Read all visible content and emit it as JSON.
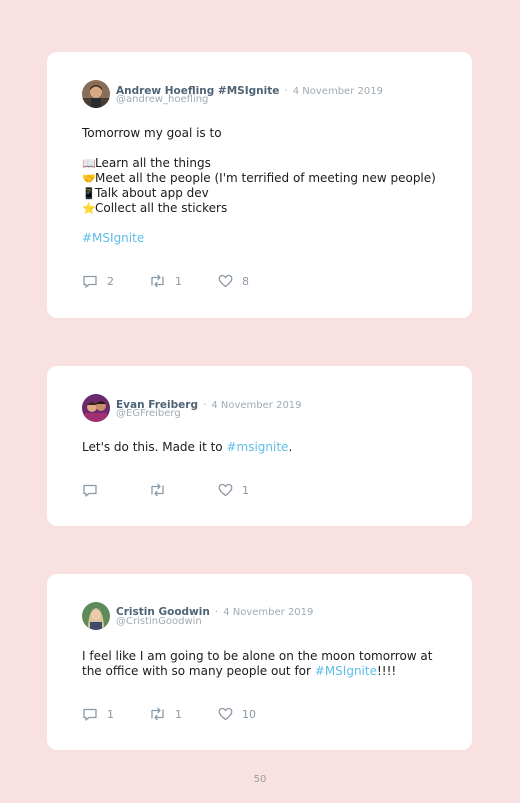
{
  "tweets": [
    {
      "author": "Andrew Hoefling #MSIgnite",
      "separator": "·",
      "date": "4 November 2019",
      "handle": "@andrew_hoefling",
      "lines": {
        "intro": "Tomorrow my goal is to",
        "item1_emoji": "📖",
        "item1": "Learn all the things",
        "item2_emoji": "🤝",
        "item2": "Meet all the people (I'm terrified of meeting new people)",
        "item3_emoji": "📱",
        "item3": "Talk about app dev",
        "item4_emoji": "⭐",
        "item4": "Collect all the stickers",
        "hashtag": "#MSIgnite"
      },
      "replies": "2",
      "retweets": "1",
      "likes": "8"
    },
    {
      "author": "Evan Freiberg",
      "separator": "·",
      "date": "4 November 2019",
      "handle": "@EGFreiberg",
      "lines": {
        "before": "Let's do this. Made it to ",
        "hashtag": "#msignite",
        "after": "."
      },
      "replies": "",
      "retweets": "",
      "likes": "1"
    },
    {
      "author": "Cristin Goodwin",
      "separator": "·",
      "date": "4 November 2019",
      "handle": "@CristinGoodwin",
      "lines": {
        "line1": "I feel like I am going to be alone on the moon tomorrow at",
        "line2_before": "the office with so many people out for ",
        "hashtag": "#MSIgnite",
        "line2_after": "!!!!"
      },
      "replies": "1",
      "retweets": "1",
      "likes": "10"
    }
  ],
  "icons": {
    "reply": "speech-bubble-icon",
    "retweet": "retweet-arrows-icon",
    "like": "heart-outline-icon"
  },
  "colors": {
    "background": "#f9e1e1",
    "card": "#ffffff",
    "hashtag": "#5ebde8",
    "name": "#4f6376",
    "meta": "#a0aab3",
    "icon": "#8b98a5"
  },
  "page_number": "50"
}
